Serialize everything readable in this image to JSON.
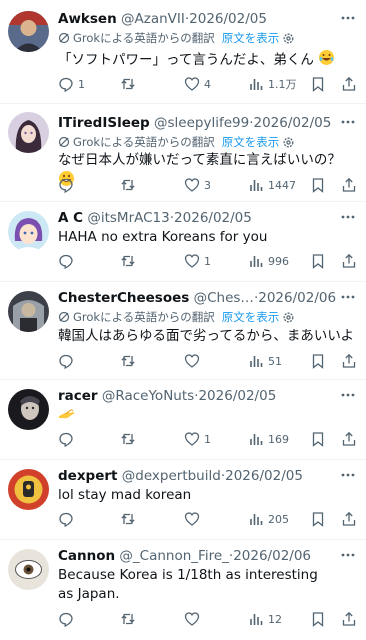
{
  "translation": {
    "label": "Grokによる英語からの翻訳",
    "show_original": "原文を表示"
  },
  "posts": [
    {
      "name": "Awksen",
      "handle": "@AzanVII",
      "date": "2026/02/05",
      "translated": true,
      "text": "「ソフトパワー」って言うんだよ、弟くん",
      "emoji": "rolling-on-floor-laughing",
      "replies": "1",
      "reposts": "",
      "likes": "4",
      "views": "1.1万"
    },
    {
      "name": "ITiredISleep",
      "handle": "@sleepylife99",
      "date": "2026/02/05",
      "translated": true,
      "text": "なぜ日本人が嫌いだって素直に言えばいいの？",
      "emoji": "grinning-face",
      "replies": "",
      "reposts": "",
      "likes": "3",
      "views": "1447"
    },
    {
      "name": "A C",
      "handle": "@itsMrAC13",
      "date": "2026/02/05",
      "translated": false,
      "text": "HAHA no extra Koreans for you",
      "replies": "",
      "reposts": "",
      "likes": "1",
      "views": "996"
    },
    {
      "name": "ChesterCheesoes",
      "handle": "@Ches…",
      "date": "2026/02/06",
      "translated": true,
      "text": "韓国人はあらゆる面で劣ってるから、まあいいよ",
      "replies": "",
      "reposts": "",
      "likes": "",
      "views": "51"
    },
    {
      "name": "racer",
      "handle": "@RaceYoNuts",
      "date": "2026/02/05",
      "translated": false,
      "text": "",
      "emoji": "pinching-hand",
      "replies": "",
      "reposts": "",
      "likes": "1",
      "views": "169"
    },
    {
      "name": "dexpert",
      "handle": "@dexpertbuild",
      "date": "2026/02/05",
      "translated": false,
      "text": "lol stay mad korean",
      "replies": "",
      "reposts": "",
      "likes": "",
      "views": "205"
    },
    {
      "name": "Cannon",
      "handle": "@_Cannon_Fire_",
      "date": "2026/02/06",
      "translated": false,
      "text": "Because Korea is 1/18th as interesting as Japan.",
      "replies": "",
      "reposts": "",
      "likes": "",
      "views": "12"
    }
  ],
  "colors": {
    "text": "#0f1419",
    "muted": "#536471",
    "link": "#1d9bf0",
    "divider": "#eff3f4"
  }
}
